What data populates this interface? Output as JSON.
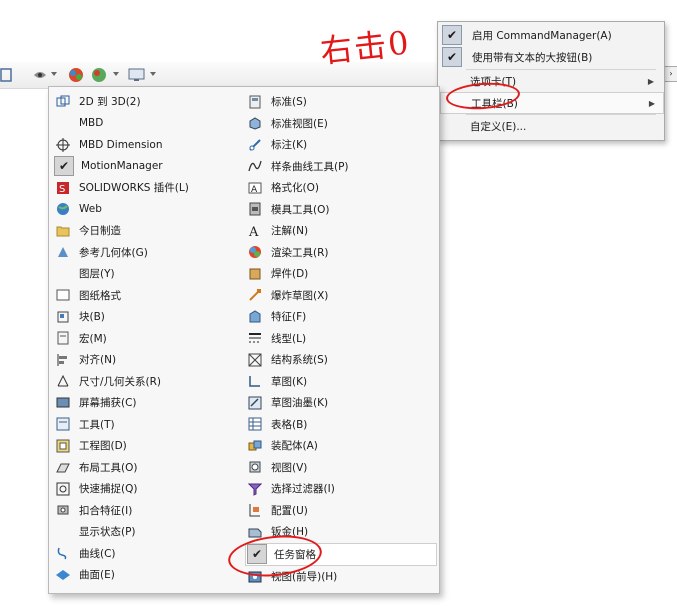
{
  "annotation": {
    "text": "右击0"
  },
  "toolbar": {
    "buttons": [
      "tree-icon",
      "eye-icon",
      "appearance-icon",
      "scene-icon",
      "display-icon"
    ]
  },
  "context_menu": {
    "items": [
      {
        "label": "启用 CommandManager(A)",
        "checked": true
      },
      {
        "label": "使用带有文本的大按钮(B)",
        "checked": true
      },
      {
        "label": "选项卡(T)",
        "submenu": true
      },
      {
        "label": "工具栏(B)",
        "submenu": true,
        "highlighted": true
      },
      {
        "label": "自定义(E)..."
      }
    ]
  },
  "toolbar_menu": {
    "left": [
      {
        "label": "2D 到 3D(2)",
        "icon": "2d-to-3d-icon"
      },
      {
        "label": "MBD",
        "icon": ""
      },
      {
        "label": "MBD Dimension",
        "icon": "crosshair-icon"
      },
      {
        "label": "MotionManager",
        "icon": "check-icon",
        "checked": true
      },
      {
        "label": "SOLIDWORKS 插件(L)",
        "icon": "addin-icon"
      },
      {
        "label": "Web",
        "icon": "globe-icon"
      },
      {
        "label": "今日制造",
        "icon": "folder-icon"
      },
      {
        "label": "参考几何体(G)",
        "icon": "ref-geometry-icon"
      },
      {
        "label": "图层(Y)",
        "icon": ""
      },
      {
        "label": "图纸格式",
        "icon": "sheet-format-icon"
      },
      {
        "label": "块(B)",
        "icon": "block-icon"
      },
      {
        "label": "宏(M)",
        "icon": "macro-icon"
      },
      {
        "label": "对齐(N)",
        "icon": "align-icon"
      },
      {
        "label": "尺寸/几何关系(R)",
        "icon": "dimension-icon"
      },
      {
        "label": "屏幕捕获(C)",
        "icon": "screen-capture-icon"
      },
      {
        "label": "工具(T)",
        "icon": "tools-icon"
      },
      {
        "label": "工程图(D)",
        "icon": "drawing-icon"
      },
      {
        "label": "布局工具(O)",
        "icon": "layout-icon"
      },
      {
        "label": "快速捕捉(Q)",
        "icon": "quick-snap-icon"
      },
      {
        "label": "扣合特征(I)",
        "icon": "fastening-icon"
      },
      {
        "label": "显示状态(P)",
        "icon": ""
      },
      {
        "label": "曲线(C)",
        "icon": "curve-icon"
      },
      {
        "label": "曲面(E)",
        "icon": "surface-icon"
      }
    ],
    "right": [
      {
        "label": "标准(S)",
        "icon": "standard-icon"
      },
      {
        "label": "标准视图(E)",
        "icon": "standard-views-icon"
      },
      {
        "label": "标注(K)",
        "icon": "annotation-icon"
      },
      {
        "label": "样条曲线工具(P)",
        "icon": "spline-icon"
      },
      {
        "label": "格式化(O)",
        "icon": "format-icon"
      },
      {
        "label": "模具工具(O)",
        "icon": "mold-icon"
      },
      {
        "label": "注解(N)",
        "icon": "note-icon"
      },
      {
        "label": "渲染工具(R)",
        "icon": "render-icon"
      },
      {
        "label": "焊件(D)",
        "icon": "weldment-icon"
      },
      {
        "label": "爆炸草图(X)",
        "icon": "explode-sketch-icon"
      },
      {
        "label": "特征(F)",
        "icon": "features-icon"
      },
      {
        "label": "线型(L)",
        "icon": "line-format-icon"
      },
      {
        "label": "结构系统(S)",
        "icon": "structure-icon"
      },
      {
        "label": "草图(K)",
        "icon": "sketch-icon"
      },
      {
        "label": "草图油墨(K)",
        "icon": "sketch-ink-icon"
      },
      {
        "label": "表格(B)",
        "icon": "table-icon"
      },
      {
        "label": "装配体(A)",
        "icon": "assembly-icon"
      },
      {
        "label": "视图(V)",
        "icon": "view-icon"
      },
      {
        "label": "选择过滤器(I)",
        "icon": "selection-filter-icon"
      },
      {
        "label": "配置(U)",
        "icon": "configuration-icon"
      },
      {
        "label": "钣金(H)",
        "icon": "sheet-metal-icon"
      },
      {
        "label": "任务窗格",
        "icon": "check-icon",
        "checked": true,
        "highlighted": true
      },
      {
        "label": "视图(前导)(H)",
        "icon": "heads-up-view-icon"
      }
    ]
  }
}
